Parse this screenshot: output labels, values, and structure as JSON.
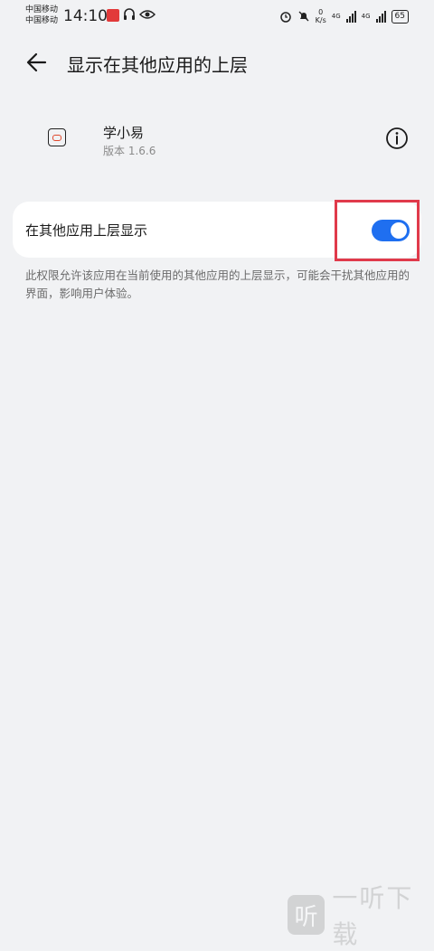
{
  "status_bar": {
    "carrier_1": "中国移动",
    "carrier_2": "中国移动",
    "time": "14:10",
    "speed_value": "0",
    "speed_unit": "K/s",
    "net_1": "4G",
    "net_2": "4G",
    "battery": "65"
  },
  "header": {
    "back_icon": "arrow-left-icon",
    "title": "显示在其他应用的上层"
  },
  "app": {
    "name": "学小易",
    "version": "版本 1.6.6",
    "info_icon": "info-icon"
  },
  "setting": {
    "label": "在其他应用上层显示",
    "enabled": true,
    "accent_color": "#1f6ff0",
    "highlight_color": "#e03a4b"
  },
  "description": "此权限允许该应用在当前使用的其他应用的上层显示，可能会干扰其他应用的界面，影响用户体验。",
  "watermark": {
    "logo_char": "听",
    "text": "一听下载"
  }
}
